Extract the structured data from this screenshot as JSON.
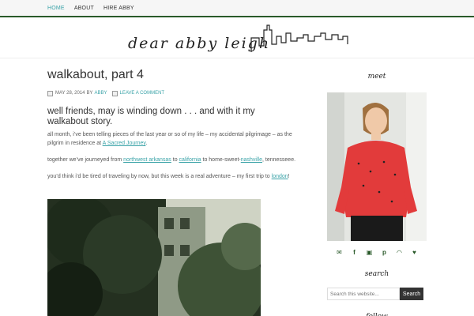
{
  "nav": {
    "items": [
      {
        "label": "HOME"
      },
      {
        "label": "ABOUT"
      },
      {
        "label": "HIRE ABBY"
      }
    ]
  },
  "header": {
    "logo_text": "dear abby leigh"
  },
  "post": {
    "title": "walkabout, part 4",
    "date": "MAY 28, 2014",
    "by": "BY",
    "author": "ABBY",
    "comment_label": "LEAVE A COMMENT",
    "lead": "well friends, may is winding down . . .  and with it my walkabout story.",
    "p1_text": "all month, i’ve been telling pieces of the last year or so of my life – my accidental pilgrimage – as the pilgrim in residence at ",
    "p1_link": "A Sacred Journey",
    "p1_end": ".",
    "p2_a": "together we’ve journeyed from ",
    "p2_link1": "northwest arkansas",
    "p2_b": " to ",
    "p2_link2": "california",
    "p2_c": " to home-sweet-",
    "p2_link3": "nashville",
    "p2_d": ", tennesseee.",
    "p3_a": "you’d think i’d be tired of traveling by now, but this week is a real adventure – my first trip to ",
    "p3_link": "london",
    "p3_end": "!"
  },
  "sidebar": {
    "meet_heading": "meet",
    "search_heading": "search",
    "search_placeholder": "Search this website...",
    "search_button": "Search",
    "follow_heading": "follow"
  },
  "colors": {
    "accent": "#3aa3a8",
    "nav_border": "#2a5a2a",
    "social_icon": "#2a5a2a"
  },
  "social_icons": [
    "mail-icon",
    "facebook-icon",
    "instagram-icon",
    "pinterest-icon",
    "rss-icon",
    "twitter-icon"
  ]
}
